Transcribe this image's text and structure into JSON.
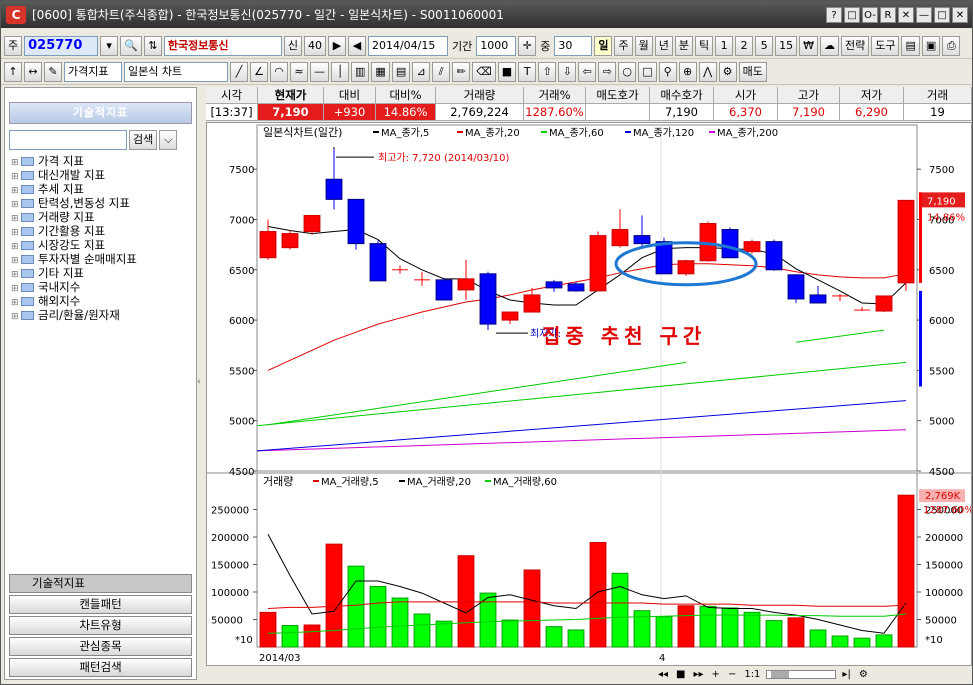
{
  "window": {
    "title": "[0600] 통합차트(주식종합) - 한국정보통신(025770 - 일간 - 일본식차트) - S0011060001",
    "logo": "C",
    "controls": [
      "?",
      "□",
      "O-",
      "R",
      "✕",
      "—",
      "□",
      "✕"
    ]
  },
  "toolbar1": {
    "market_label": "주",
    "code": "025770",
    "name": "한국정보통신",
    "badge1": "신",
    "badge2": "40",
    "date": "2014/04/15",
    "period_label": "기간",
    "period_value": "1000",
    "count_label": "중",
    "count_value": "30",
    "timeframes": [
      "일",
      "주",
      "월",
      "년",
      "분",
      "틱",
      "1",
      "2",
      "5",
      "15",
      "₩"
    ],
    "strategy_button": "전략",
    "tools_button": "도구"
  },
  "toolbar2": {
    "indicator_dropdown": "가격지표",
    "chart_type_dropdown": "일본식 차트",
    "sell_button": "매도"
  },
  "left_panel": {
    "header": "기술적지표",
    "search_button": "검색",
    "search_value": "",
    "tree_items": [
      "가격 지표",
      "대신개발 지표",
      "추세 지표",
      "탄력성,변동성 지표",
      "거래량 지표",
      "기간활용 지표",
      "시장강도 지표",
      "투자자별 순매매지표",
      "기타 지표",
      "국내지수",
      "해외지수",
      "금리/환율/원자재"
    ],
    "tabs": [
      "기술적지표",
      "캔들패턴",
      "차트유형",
      "관심종목",
      "패턴검색"
    ]
  },
  "quote": {
    "headers": [
      "시각",
      "현재가",
      "대비",
      "대비%",
      "거래량",
      "거래%",
      "매도호가",
      "매수호가",
      "시가",
      "고가",
      "저가",
      "거래"
    ],
    "values": [
      "[13:37]",
      "7,190",
      "+930",
      "14.86%",
      "2,769,224",
      "1287.60%",
      "",
      "7,190",
      "6,370",
      "7,190",
      "6,290",
      "19"
    ]
  },
  "chart_data": [
    {
      "type": "candlestick",
      "legend_title": "일본식차트(일간)",
      "series": [
        {
          "name": "MA_종가,5",
          "color": "#000000"
        },
        {
          "name": "MA_종가,20",
          "color": "#e00000"
        },
        {
          "name": "MA_종가,60",
          "color": "#00cc00"
        },
        {
          "name": "MA_종가,120",
          "color": "#0000e0"
        },
        {
          "name": "MA_종가,200",
          "color": "#cc00cc"
        }
      ],
      "y_ticks": [
        4500,
        5000,
        5500,
        6000,
        6500,
        7000,
        7500
      ],
      "ylim": [
        4500,
        7800
      ],
      "annotations": {
        "high": "최고가: 7,720 (2014/03/10)",
        "low": "최저가:",
        "overlay": "집중 추천 구간"
      },
      "price_tag": "7,190",
      "pct_tag": "14.86%",
      "candles": [
        {
          "o": 6620,
          "h": 7000,
          "l": 6600,
          "c": 6880
        },
        {
          "o": 6720,
          "h": 6890,
          "l": 6700,
          "c": 6860
        },
        {
          "o": 6880,
          "h": 7040,
          "l": 6850,
          "c": 7040
        },
        {
          "o": 7400,
          "h": 7720,
          "l": 7100,
          "c": 7200
        },
        {
          "o": 7200,
          "h": 7200,
          "l": 6700,
          "c": 6760
        },
        {
          "o": 6760,
          "h": 6790,
          "l": 6390,
          "c": 6390
        },
        {
          "o": 6500,
          "h": 6540,
          "l": 6460,
          "c": 6500
        },
        {
          "o": 6400,
          "h": 6480,
          "l": 6340,
          "c": 6400
        },
        {
          "o": 6400,
          "h": 6420,
          "l": 6200,
          "c": 6200
        },
        {
          "o": 6300,
          "h": 6600,
          "l": 6200,
          "c": 6410
        },
        {
          "o": 6460,
          "h": 6480,
          "l": 5900,
          "c": 5960
        },
        {
          "o": 6000,
          "h": 6080,
          "l": 5960,
          "c": 6080
        },
        {
          "o": 6080,
          "h": 6320,
          "l": 6080,
          "c": 6250
        },
        {
          "o": 6380,
          "h": 6400,
          "l": 6280,
          "c": 6320
        },
        {
          "o": 6360,
          "h": 6380,
          "l": 6280,
          "c": 6290
        },
        {
          "o": 6290,
          "h": 6880,
          "l": 6290,
          "c": 6840
        },
        {
          "o": 6740,
          "h": 7100,
          "l": 6720,
          "c": 6900
        },
        {
          "o": 6840,
          "h": 7040,
          "l": 6720,
          "c": 6760
        },
        {
          "o": 6780,
          "h": 6820,
          "l": 6460,
          "c": 6460
        },
        {
          "o": 6460,
          "h": 6600,
          "l": 6440,
          "c": 6590
        },
        {
          "o": 6590,
          "h": 6980,
          "l": 6580,
          "c": 6960
        },
        {
          "o": 6900,
          "h": 6920,
          "l": 6620,
          "c": 6620
        },
        {
          "o": 6680,
          "h": 6800,
          "l": 6660,
          "c": 6780
        },
        {
          "o": 6780,
          "h": 6800,
          "l": 6490,
          "c": 6500
        },
        {
          "o": 6450,
          "h": 6450,
          "l": 6170,
          "c": 6210
        },
        {
          "o": 6250,
          "h": 6340,
          "l": 6170,
          "c": 6170
        },
        {
          "o": 6240,
          "h": 6260,
          "l": 6190,
          "c": 6240
        },
        {
          "o": 6100,
          "h": 6130,
          "l": 6090,
          "c": 6100
        },
        {
          "o": 6090,
          "h": 6240,
          "l": 6080,
          "c": 6240
        },
        {
          "o": 6370,
          "h": 7190,
          "l": 6290,
          "c": 7190
        }
      ],
      "ma5": [
        6930,
        6890,
        6860,
        6880,
        6900,
        6800,
        6610,
        6500,
        6410,
        6410,
        6290,
        6200,
        6170,
        6150,
        6150,
        6300,
        6450,
        6620,
        6710,
        6720,
        6720,
        6710,
        6700,
        6660,
        6510,
        6400,
        6290,
        6170,
        6160,
        6370
      ],
      "ma20": [
        5500,
        5600,
        5700,
        5800,
        5880,
        5960,
        6020,
        6080,
        6130,
        6180,
        6210,
        6250,
        6300,
        6340,
        6380,
        6420,
        6470,
        6510,
        6550,
        6560,
        6560,
        6550,
        6540,
        6520,
        6480,
        6450,
        6430,
        6420,
        6420,
        6460
      ],
      "ma60_seg1": {
        "from_idx": 0,
        "to_idx": 19,
        "from": 4960,
        "to": 5580
      },
      "ma60_seg2": {
        "from_idx": 24,
        "to_idx": 28,
        "from": 5780,
        "to": 5900
      },
      "ma120": {
        "from": 5300,
        "to": 5650
      },
      "ma120b": {
        "from": 4880,
        "to": 5000
      },
      "ma200": {
        "from": 4700,
        "to": 4910
      },
      "ma_blue": {
        "from": 4700,
        "to": 5200
      },
      "ma_green": {
        "from": 4950,
        "to": 5580
      }
    },
    {
      "type": "bar",
      "legend_title": "거래량",
      "series": [
        {
          "name": "MA_거래량,5",
          "color": "#e00000"
        },
        {
          "name": "MA_거래량,20",
          "color": "#000000"
        },
        {
          "name": "MA_거래량,60",
          "color": "#00cc00"
        }
      ],
      "y_ticks": [
        50000,
        100000,
        150000,
        200000,
        250000
      ],
      "ylim": [
        0,
        280000
      ],
      "scale_label": "*10",
      "value_tag": "2,769K",
      "pct_tag": "1287.60%",
      "x_labels": [
        "2014/03",
        "4"
      ],
      "volumes": [
        63000,
        39000,
        40000,
        187000,
        147000,
        110000,
        89000,
        60000,
        47000,
        166000,
        98000,
        49000,
        140000,
        37000,
        31000,
        190000,
        134000,
        66000,
        55000,
        75000,
        74000,
        71000,
        63000,
        48000,
        53000,
        31000,
        20000,
        16000,
        22000,
        276000
      ],
      "up_flags": [
        1,
        0,
        1,
        1,
        0,
        0,
        0,
        0,
        0,
        1,
        0,
        0,
        1,
        0,
        0,
        1,
        0,
        0,
        0,
        1,
        0,
        0,
        0,
        0,
        1,
        0,
        0,
        0,
        0,
        1
      ],
      "ma5": [
        205000,
        130000,
        60000,
        65000,
        120000,
        120000,
        110000,
        98000,
        80000,
        62000,
        90000,
        95000,
        85000,
        75000,
        70000,
        100000,
        110000,
        95000,
        88000,
        93000,
        72000,
        70000,
        70000,
        63000,
        58000,
        50000,
        40000,
        30000,
        25000,
        80000
      ],
      "ma20": [
        70000,
        72000,
        72000,
        74000,
        76000,
        80000,
        82000,
        82000,
        82000,
        82000,
        82000,
        82000,
        82000,
        80000,
        80000,
        80000,
        80000,
        80000,
        78000,
        78000,
        78000,
        78000,
        76000,
        76000,
        76000,
        74000,
        74000,
        74000,
        74000,
        76000
      ],
      "ma60": [
        25000,
        26000,
        28000,
        30000,
        33000,
        36000,
        38000,
        40000,
        42000,
        44000,
        46000,
        47000,
        48000,
        49000,
        50000,
        52000,
        54000,
        55000,
        56000,
        57000,
        58000,
        58000,
        58000,
        58000,
        57000,
        57000,
        56000,
        56000,
        56000,
        60000
      ]
    }
  ]
}
